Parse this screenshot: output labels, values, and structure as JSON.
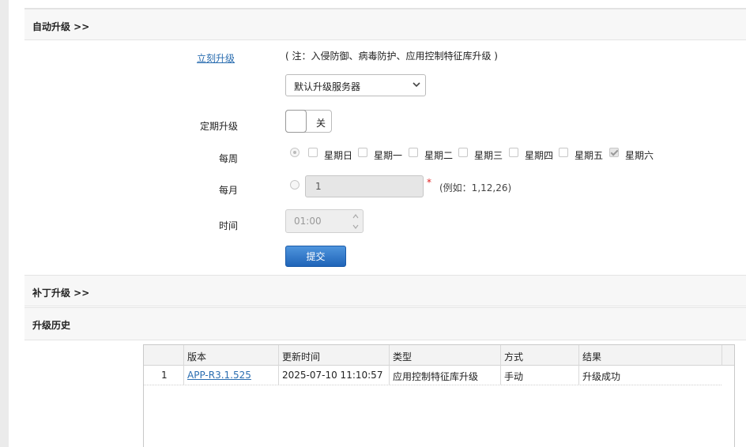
{
  "auto_upgrade": {
    "header": "自动升级 >>",
    "now_link": "立刻升级",
    "note": "( 注：入侵防御、病毒防护、应用控制特征库升级 )",
    "server_select": "默认升级服务器",
    "schedule_label": "定期升级",
    "schedule_toggle": "关",
    "weekly_label": "每周",
    "days": [
      "星期日",
      "星期一",
      "星期二",
      "星期三",
      "星期四",
      "星期五",
      "星期六"
    ],
    "days_checked": [
      false,
      false,
      false,
      false,
      false,
      false,
      true
    ],
    "weekly_selected": true,
    "monthly_label": "每月",
    "monthly_value": "1",
    "monthly_required_mark": "*",
    "monthly_hint": "(例如：1,12,26)",
    "time_label": "时间",
    "time_value": "01:00",
    "submit": "提交"
  },
  "patch_upgrade": {
    "header": "补丁升级 >>"
  },
  "history": {
    "header": "升级历史",
    "columns": [
      "版本",
      "更新时间",
      "类型",
      "方式",
      "结果"
    ],
    "rows": [
      {
        "index": "1",
        "version": "APP-R3.1.525",
        "time": "2025-07-10 11:10:57",
        "type": "应用控制特征库升级",
        "method": "手动",
        "result": "升级成功"
      }
    ]
  },
  "colors": {
    "accent": "#1f64b8",
    "link": "#2a6db0",
    "required": "#e02020"
  }
}
